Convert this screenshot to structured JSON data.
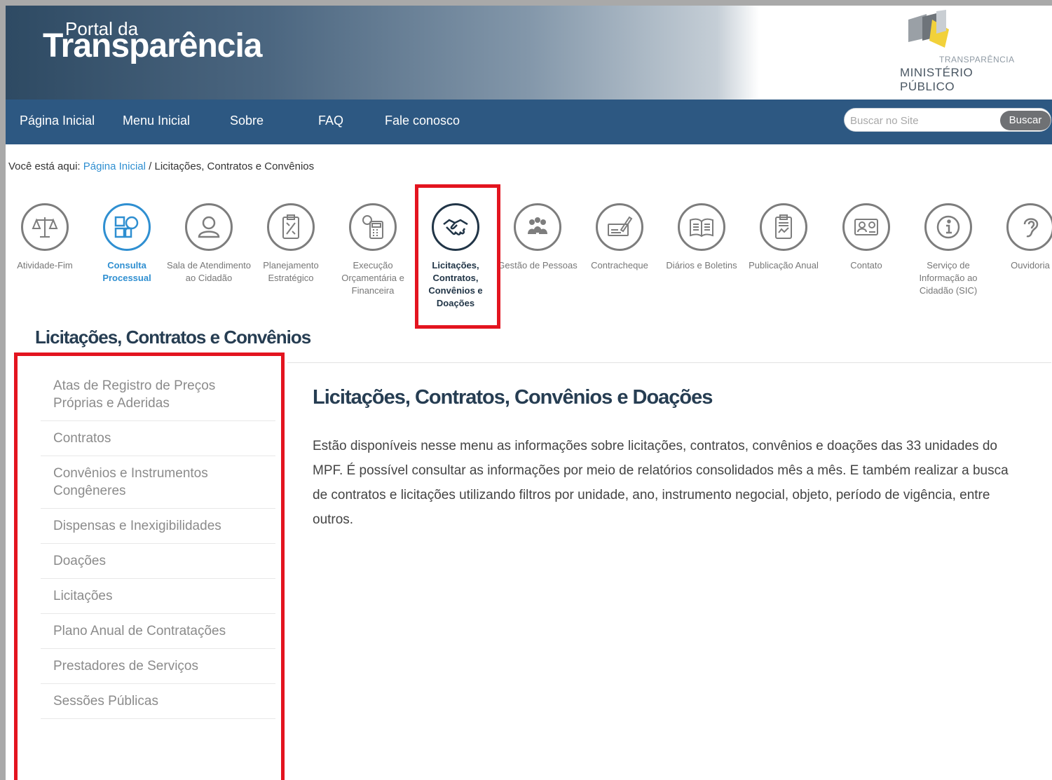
{
  "header": {
    "logo_small": "Portal da",
    "logo_big": "Transparência",
    "mp_subtitle": "TRANSPARÊNCIA",
    "mp_title": "MINISTÉRIO PÚBLICO"
  },
  "nav": {
    "items": [
      {
        "label": "Página Inicial"
      },
      {
        "label": "Menu Inicial"
      },
      {
        "label": "Sobre"
      },
      {
        "label": "FAQ"
      },
      {
        "label": "Fale conosco"
      }
    ],
    "search_placeholder": "Buscar no Site",
    "search_button": "Buscar"
  },
  "breadcrumb": {
    "prefix": "Você está aqui:",
    "home": "Página Inicial",
    "separator": "/",
    "current": "Licitações, Contratos e Convênios"
  },
  "icons": [
    {
      "label": "Atividade-Fim",
      "icon": "scale-icon"
    },
    {
      "label": "Consulta Processual",
      "icon": "process-search-icon"
    },
    {
      "label": "Sala de Atendimento ao Cidadão",
      "icon": "person-icon"
    },
    {
      "label": "Planejamento Estratégico",
      "icon": "clipboard-plan-icon"
    },
    {
      "label": "Execução Orçamentária e Financeira",
      "icon": "calculator-icon"
    },
    {
      "label": "Licitações, Contratos, Convênios e Doações",
      "icon": "handshake-icon"
    },
    {
      "label": "Gestão de Pessoas",
      "icon": "people-icon"
    },
    {
      "label": "Contracheque",
      "icon": "check-pen-icon"
    },
    {
      "label": "Diários e Boletins",
      "icon": "book-icon"
    },
    {
      "label": "Publicação Anual",
      "icon": "document-chart-icon"
    },
    {
      "label": "Contato",
      "icon": "contact-card-icon"
    },
    {
      "label": "Serviço de Informação ao Cidadão (SIC)",
      "icon": "info-icon"
    },
    {
      "label": "Ouvidoria",
      "icon": "ear-icon"
    }
  ],
  "section_title": "Licitações, Contratos e Convênios",
  "side_menu": [
    {
      "label": "Atas de Registro de Preços Próprias e Aderidas"
    },
    {
      "label": "Contratos"
    },
    {
      "label": "Convênios e Instrumentos Congêneres"
    },
    {
      "label": "Dispensas e Inexigibilidades"
    },
    {
      "label": "Doações"
    },
    {
      "label": "Licitações"
    },
    {
      "label": "Plano Anual de Contratações"
    },
    {
      "label": "Prestadores de Serviços"
    },
    {
      "label": "Sessões Públicas"
    }
  ],
  "content": {
    "title": "Licitações, Contratos, Convênios e Doações",
    "text": "Estão disponíveis nesse menu as informações sobre licitações, contratos, convênios e doações das 33 unidades do MPF. É possível consultar as informações por meio de relatórios consolidados mês a mês. E também realizar a busca de contratos e licitações utilizando filtros por unidade, ano, instrumento negocial, objeto, período de vigência, entre outros."
  },
  "colors": {
    "nav_bg": "#2d5882",
    "link": "#2f8fd1",
    "highlight_border": "#e3141f",
    "title": "#263d52"
  }
}
